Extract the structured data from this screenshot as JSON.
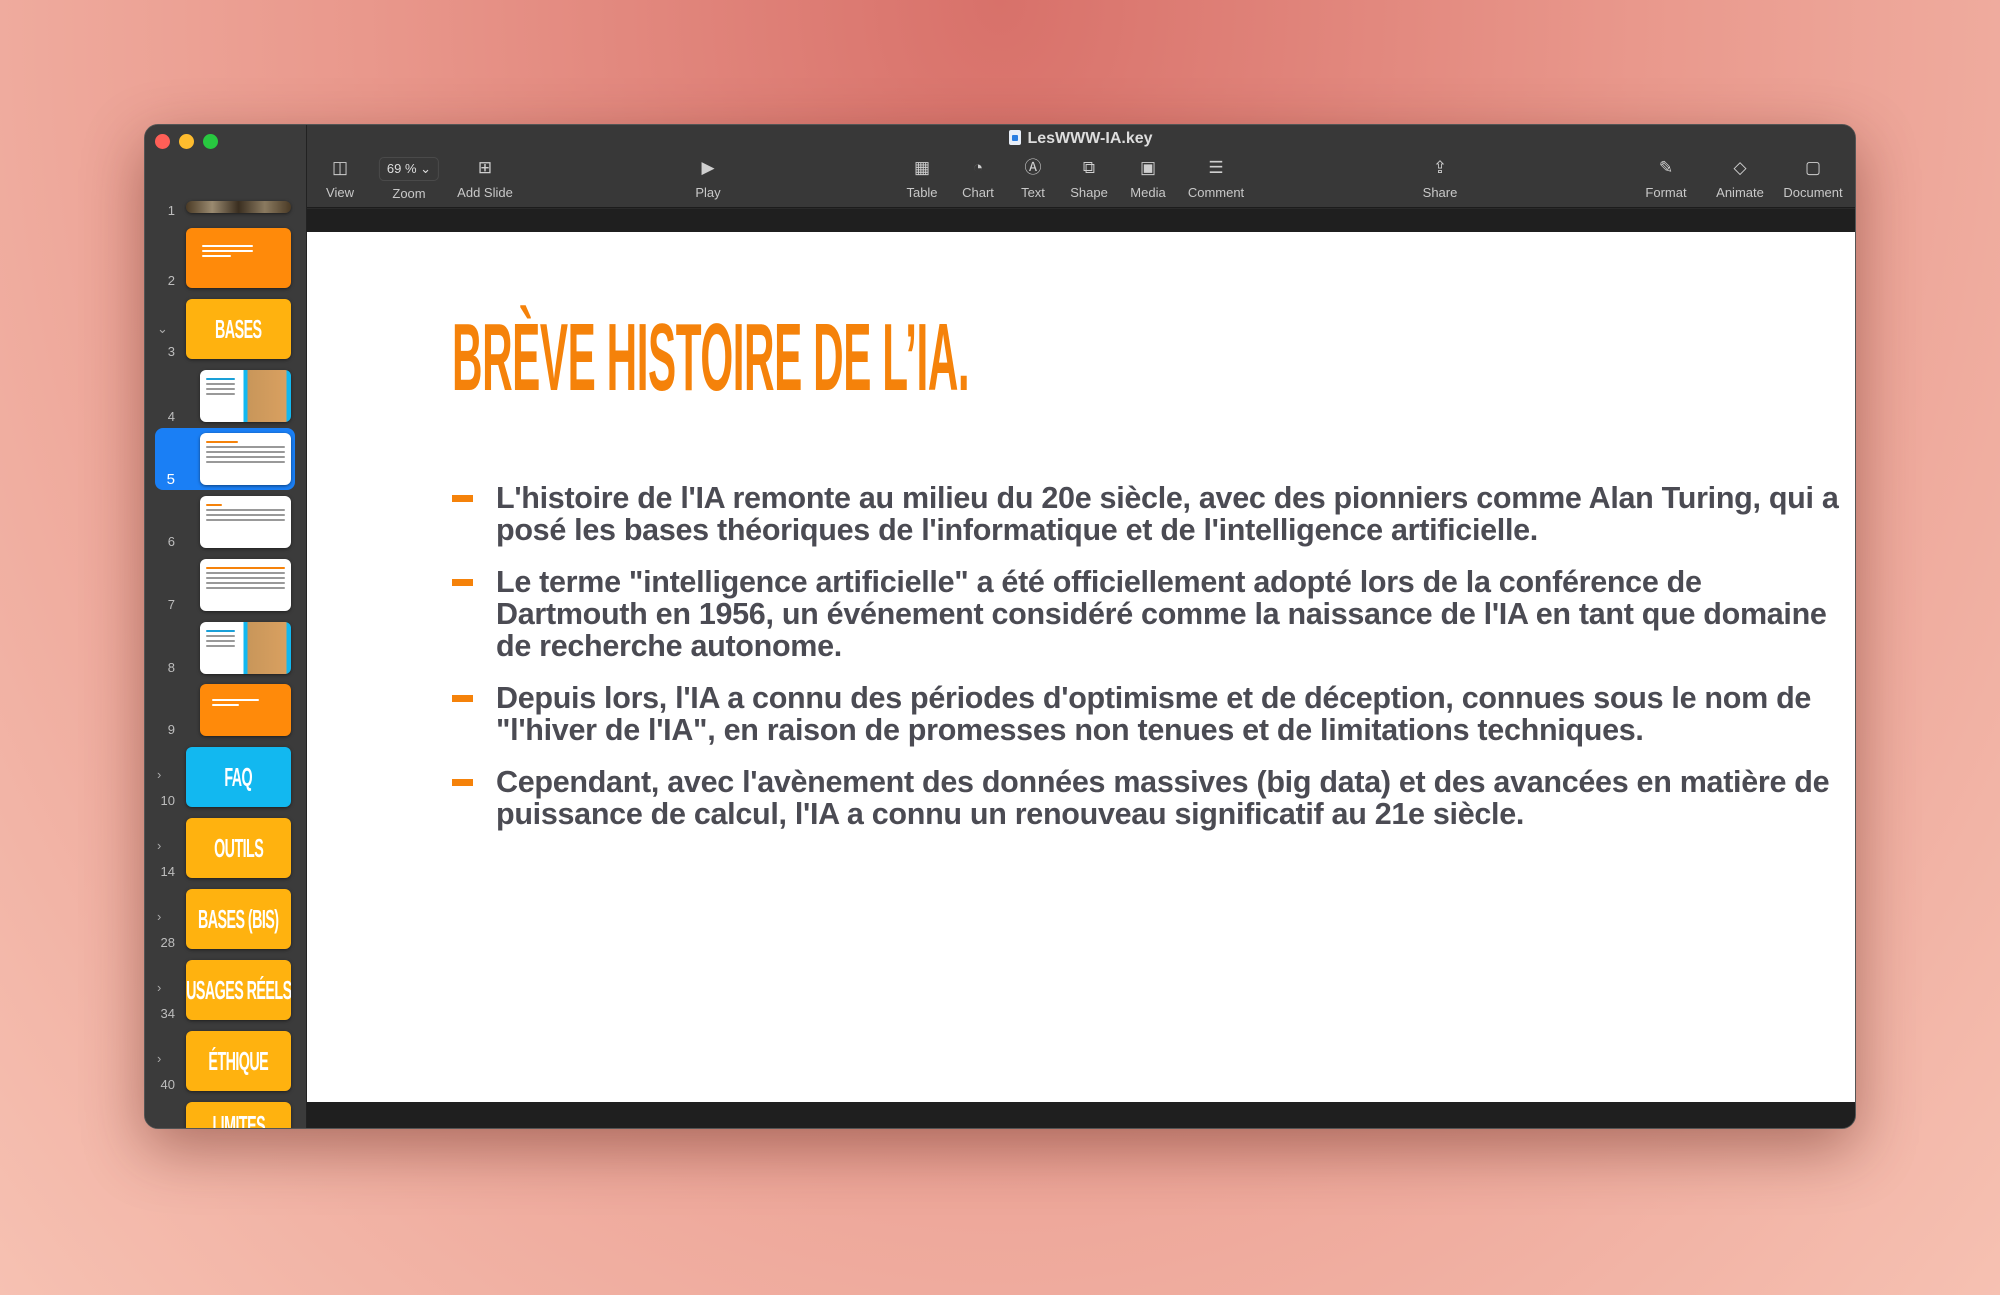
{
  "window": {
    "title": "LesWWW-IA.key"
  },
  "toolbar": {
    "view": "View",
    "zoom_value": "69 %",
    "zoom": "Zoom",
    "add_slide": "Add Slide",
    "play": "Play",
    "table": "Table",
    "chart": "Chart",
    "text": "Text",
    "shape": "Shape",
    "media": "Media",
    "comment": "Comment",
    "share": "Share",
    "format": "Format",
    "animate": "Animate",
    "document": "Document"
  },
  "slide": {
    "title": "BRÈVE HISTOIRE DE L’IA.",
    "bullets": [
      "L'histoire de l'IA remonte au milieu du 20e siècle, avec des pionniers comme Alan Turing, qui a posé les bases théoriques de l'informatique et de l'intelligence artificielle.",
      "Le terme \"intelligence artificielle\" a été officiellement adopté lors de la conférence de Dartmouth en 1956, un événement considéré comme la naissance de l'IA en tant que domaine de recherche autonome.",
      "Depuis lors, l'IA a connu des périodes d'optimisme et de déception, connues sous le nom de \"l'hiver de l'IA\", en raison de promesses non tenues et de limitations techniques.",
      "Cependant, avec l'avènement des données massives (big data) et des avancées en matière de puissance de calcul, l'IA a connu un renouveau significatif au 21e siècle."
    ]
  },
  "navigator": {
    "selected": "5",
    "slides": [
      {
        "num": "1"
      },
      {
        "num": "2"
      },
      {
        "num": "3",
        "label": "BASES"
      },
      {
        "num": "4"
      },
      {
        "num": "5"
      },
      {
        "num": "6"
      },
      {
        "num": "7"
      },
      {
        "num": "8"
      },
      {
        "num": "9"
      },
      {
        "num": "10",
        "label": "FAQ"
      },
      {
        "num": "14",
        "label": "OUTILS"
      },
      {
        "num": "28",
        "label": "BASES (BIS)"
      },
      {
        "num": "34",
        "label": "USAGES RÉELS"
      },
      {
        "num": "40",
        "label": "ÉTHIQUE"
      },
      {
        "label": "LIMITES"
      }
    ]
  },
  "colors": {
    "accent": "#f5820a",
    "section": "#ffb20f",
    "faq": "#12b8f0",
    "selection": "#1a7ff5"
  }
}
